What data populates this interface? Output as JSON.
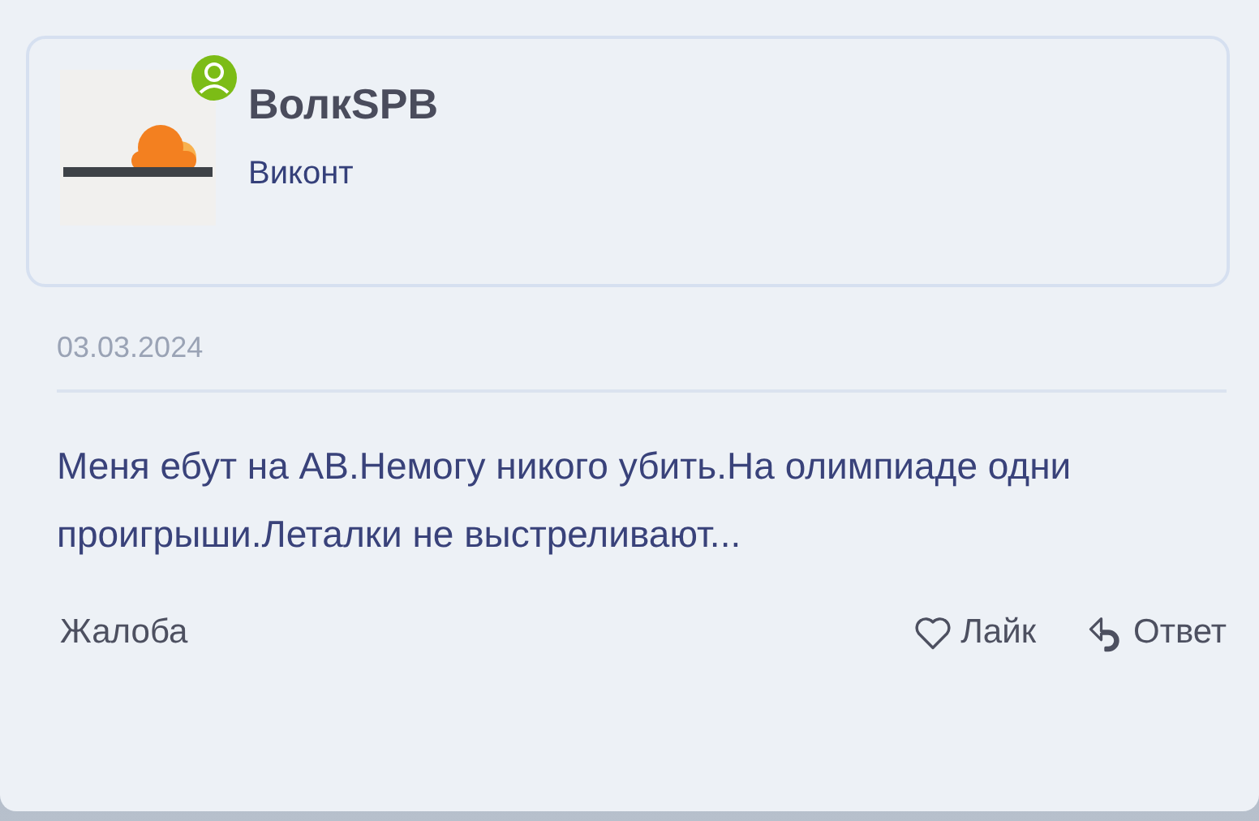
{
  "author": {
    "name": "ВолкSPB",
    "rank": "Виконт",
    "online": true
  },
  "date": "03.03.2024",
  "message": "Меня ебут на АВ.Немогу никого убить.На олимпиаде одни проигрыши.Леталки не выстреливают...",
  "actions": [
    {
      "kind": "report",
      "label": "Жалоба"
    },
    {
      "kind": "like",
      "label": "Лайк"
    },
    {
      "kind": "reply",
      "label": "Ответ"
    }
  ]
}
